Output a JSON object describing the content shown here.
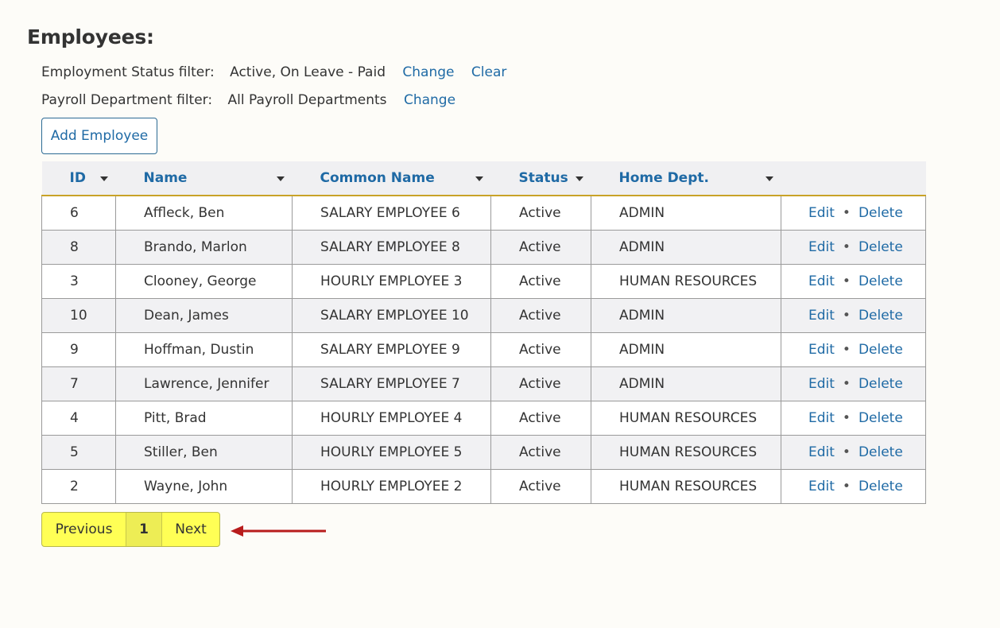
{
  "page": {
    "title": "Employees:"
  },
  "filters": [
    {
      "label": "Employment Status filter:",
      "value": "Active, On Leave - Paid",
      "links": [
        "Change",
        "Clear"
      ]
    },
    {
      "label": "Payroll Department filter:",
      "value": "All Payroll Departments",
      "links": [
        "Change"
      ]
    }
  ],
  "toolbar": {
    "add_label": "Add Employee"
  },
  "table": {
    "columns": [
      "ID",
      "Name",
      "Common Name",
      "Status",
      "Home Dept."
    ],
    "actions": {
      "edit": "Edit",
      "separator": "•",
      "delete": "Delete"
    },
    "rows": [
      {
        "id": "6",
        "name": "Affleck, Ben",
        "common": "SALARY EMPLOYEE 6",
        "status": "Active",
        "dept": "ADMIN"
      },
      {
        "id": "8",
        "name": "Brando, Marlon",
        "common": "SALARY EMPLOYEE 8",
        "status": "Active",
        "dept": "ADMIN"
      },
      {
        "id": "3",
        "name": "Clooney, George",
        "common": "HOURLY EMPLOYEE 3",
        "status": "Active",
        "dept": "HUMAN RESOURCES"
      },
      {
        "id": "10",
        "name": "Dean, James",
        "common": "SALARY EMPLOYEE 10",
        "status": "Active",
        "dept": "ADMIN"
      },
      {
        "id": "9",
        "name": "Hoffman, Dustin",
        "common": "SALARY EMPLOYEE 9",
        "status": "Active",
        "dept": "ADMIN"
      },
      {
        "id": "7",
        "name": "Lawrence, Jennifer",
        "common": "SALARY EMPLOYEE 7",
        "status": "Active",
        "dept": "ADMIN"
      },
      {
        "id": "4",
        "name": "Pitt, Brad",
        "common": "HOURLY EMPLOYEE 4",
        "status": "Active",
        "dept": "HUMAN RESOURCES"
      },
      {
        "id": "5",
        "name": "Stiller, Ben",
        "common": "HOURLY EMPLOYEE 5",
        "status": "Active",
        "dept": "HUMAN RESOURCES"
      },
      {
        "id": "2",
        "name": "Wayne, John",
        "common": "HOURLY EMPLOYEE 2",
        "status": "Active",
        "dept": "HUMAN RESOURCES"
      }
    ]
  },
  "pagination": {
    "previous": "Previous",
    "current": "1",
    "next": "Next"
  },
  "colors": {
    "link": "#1f6aa5",
    "header_underline": "#c9a227",
    "pager_highlight": "#ffff55",
    "arrow": "#b81c1c"
  }
}
